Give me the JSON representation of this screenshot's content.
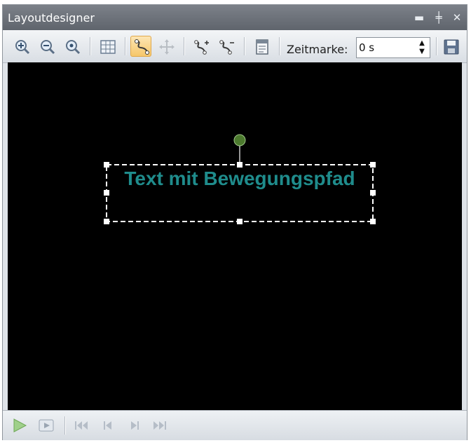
{
  "window": {
    "title": "Layoutdesigner"
  },
  "titlebar_buttons": {
    "minimize_icon": "minimize-icon",
    "pin_icon": "pin-icon",
    "close_icon": "close-icon",
    "minimize_glyph": "▬",
    "pin_glyph": "╪",
    "close_glyph": "✕"
  },
  "toolbar": {
    "timestamp_label": "Zeitmarke:",
    "timestamp_value": "0 s",
    "spin_up": "▲",
    "spin_down": "▼"
  },
  "canvas": {
    "background": "#000000",
    "text_object": {
      "text": "Text mit Bewegungspfad",
      "color": "#1f8c8c"
    },
    "rotation_handle_color": "#4c7a2e"
  },
  "playback": {
    "play_icon": "play-icon",
    "preview_icon": "preview-icon",
    "first_icon": "first-frame-icon",
    "prev_icon": "previous-frame-icon",
    "next_icon": "next-frame-icon",
    "last_icon": "last-frame-icon"
  }
}
